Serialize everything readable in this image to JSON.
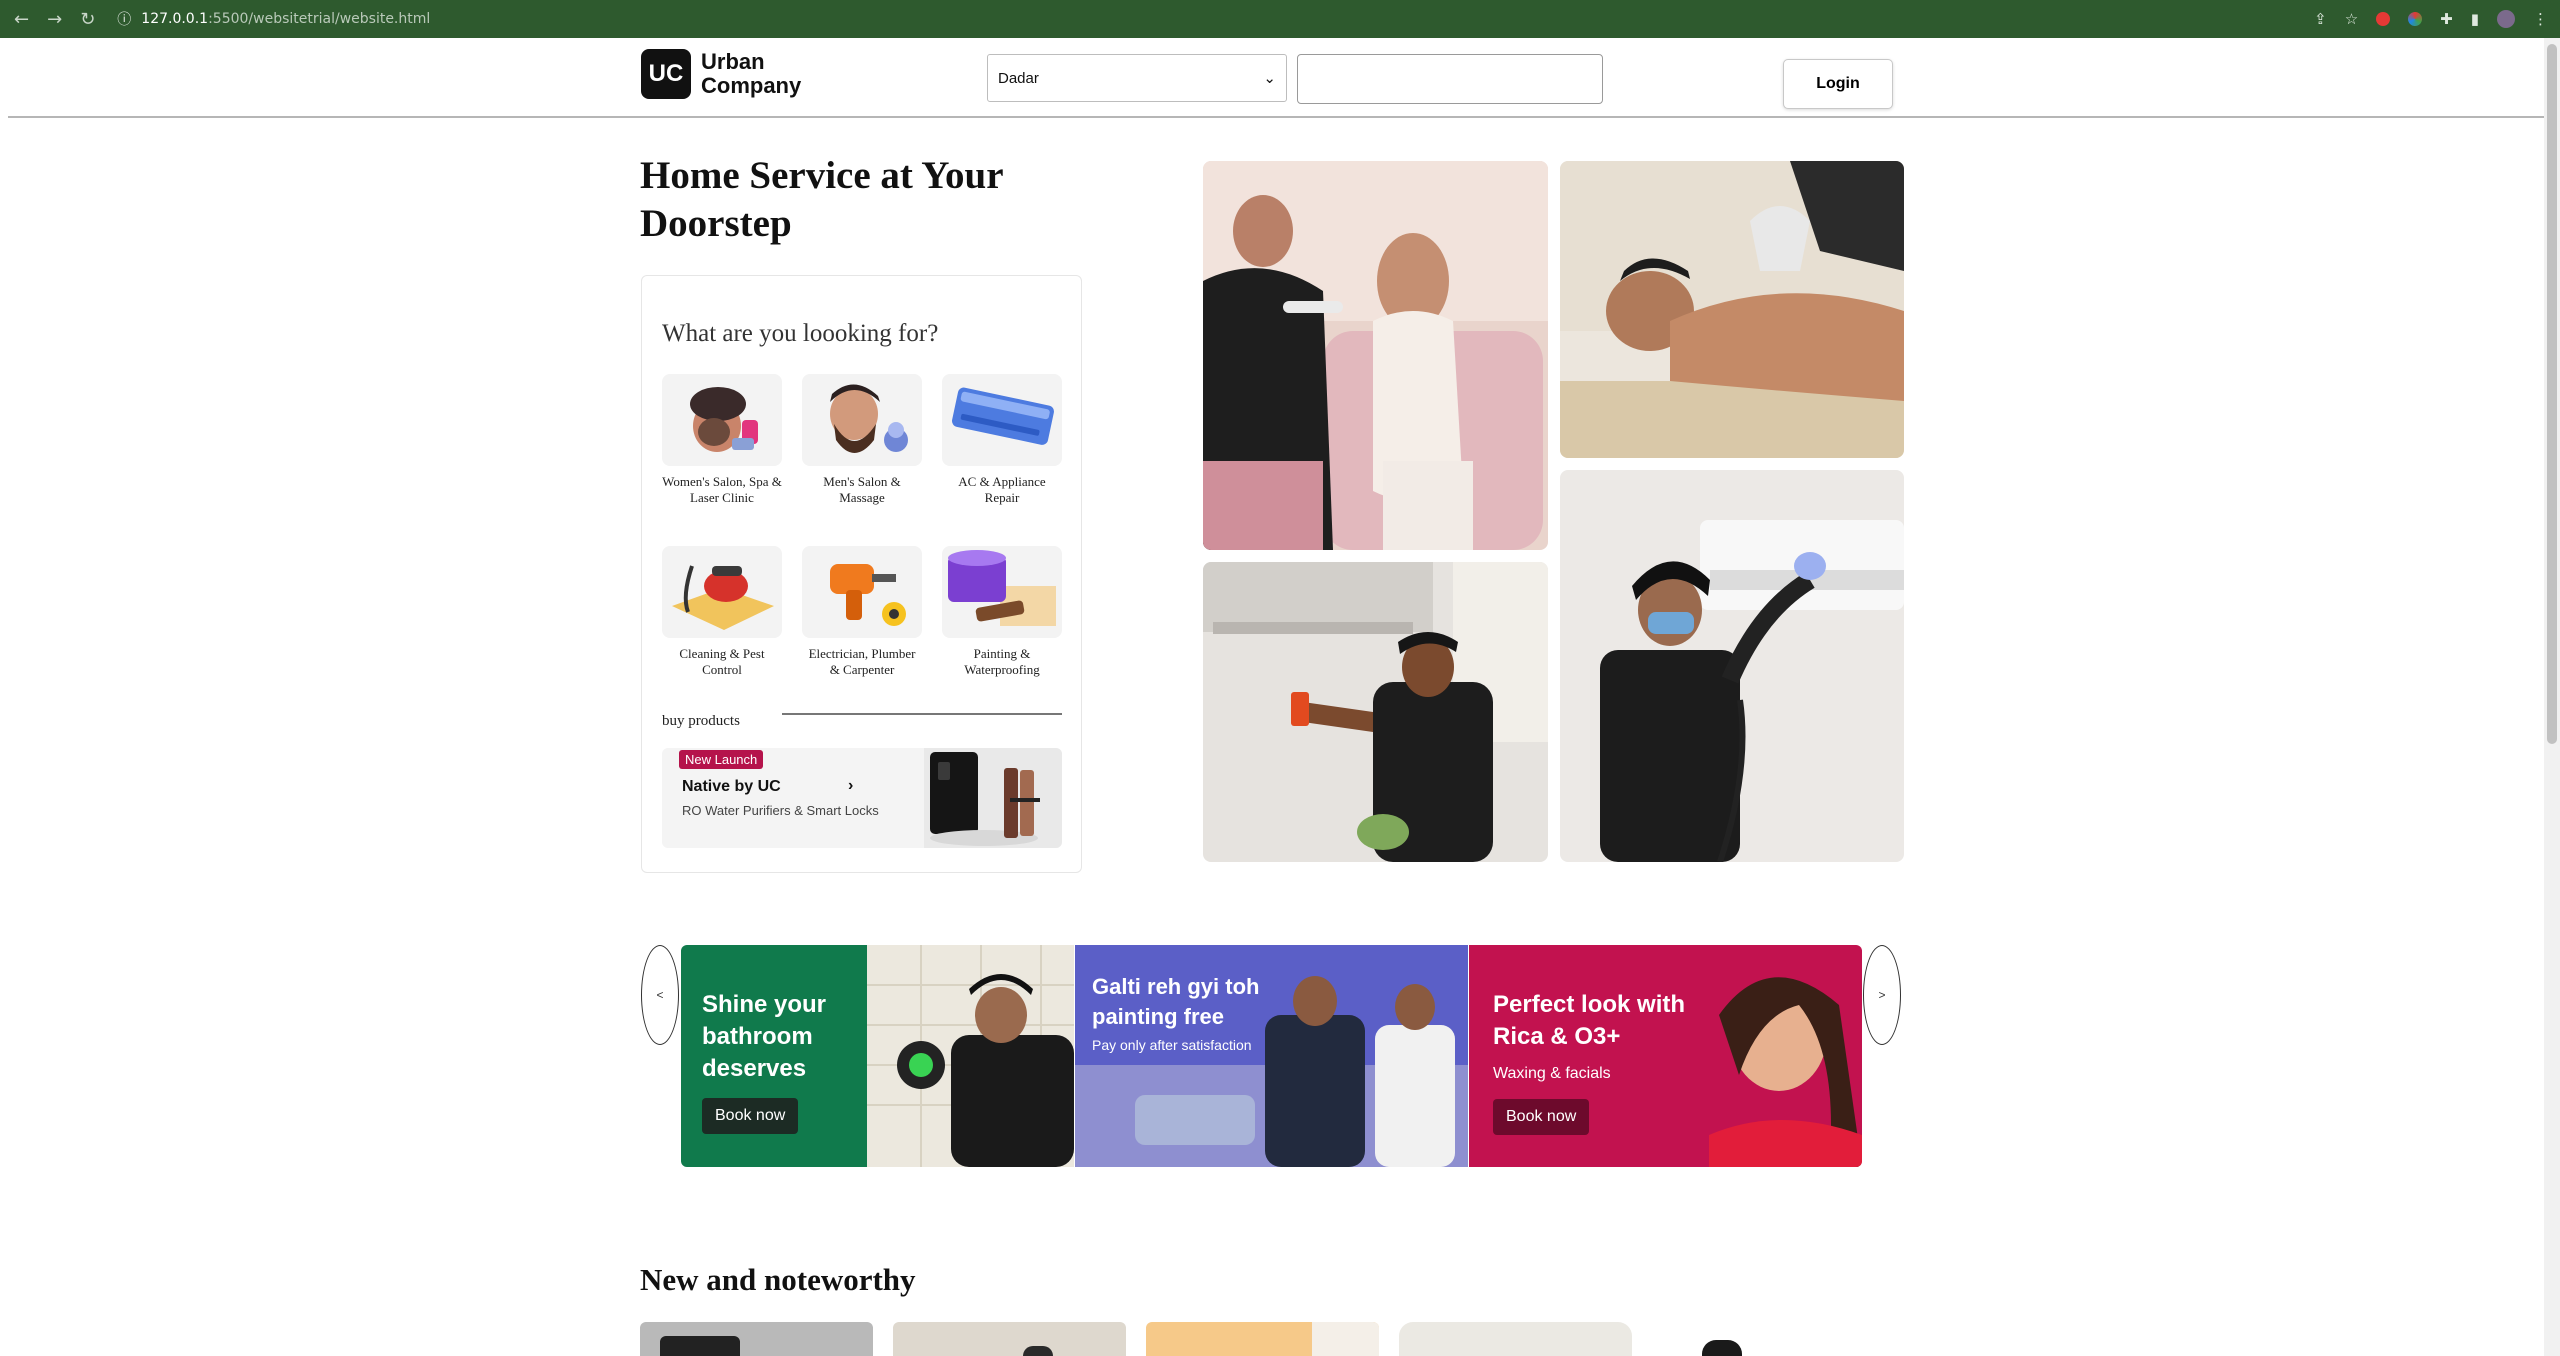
{
  "browser": {
    "url_host": "127.0.0.1",
    "url_path": ":5500/websitetrial/website.html"
  },
  "header": {
    "logo_mark": "UC",
    "logo_line1": "Urban",
    "logo_line2": "Company",
    "city_selected": "Dadar",
    "search_value": "",
    "login_label": "Login"
  },
  "hero": {
    "title": "Home Service at Your Doorstep",
    "question": "What are you loooking for?",
    "services": [
      {
        "label": "Women's Salon, Spa & Laser Clinic",
        "icon": "woman-facial-icon"
      },
      {
        "label": "Men's Salon & Massage",
        "icon": "man-beard-icon"
      },
      {
        "label": "AC & Appliance Repair",
        "icon": "ac-unit-icon"
      },
      {
        "label": "Cleaning & Pest Control",
        "icon": "vacuum-icon"
      },
      {
        "label": "Electrician, Plumber & Carpenter",
        "icon": "drill-icon"
      },
      {
        "label": "Painting & Waterproofing",
        "icon": "paint-bucket-icon"
      }
    ],
    "buy_products_label": "buy products",
    "native": {
      "badge": "New Launch",
      "title": "Native by UC",
      "chevron": "›",
      "subtitle": "RO Water Purifiers & Smart Locks"
    }
  },
  "carousel": {
    "prev": "<",
    "next": ">",
    "banners": [
      {
        "headline": "Shine your bathroom deserves",
        "subtitle": "",
        "cta": "Book now",
        "bg": "#107a4c"
      },
      {
        "headline": "Galti reh gyi toh painting free",
        "subtitle": "Pay only after satisfaction",
        "cta": "",
        "bg": "#5b5fc7"
      },
      {
        "headline": "Perfect look with Rica & O3+",
        "subtitle": "Waxing & facials",
        "cta": "Book now",
        "bg": "#c2124f"
      }
    ]
  },
  "section": {
    "new_and_noteworthy": "New and noteworthy"
  }
}
